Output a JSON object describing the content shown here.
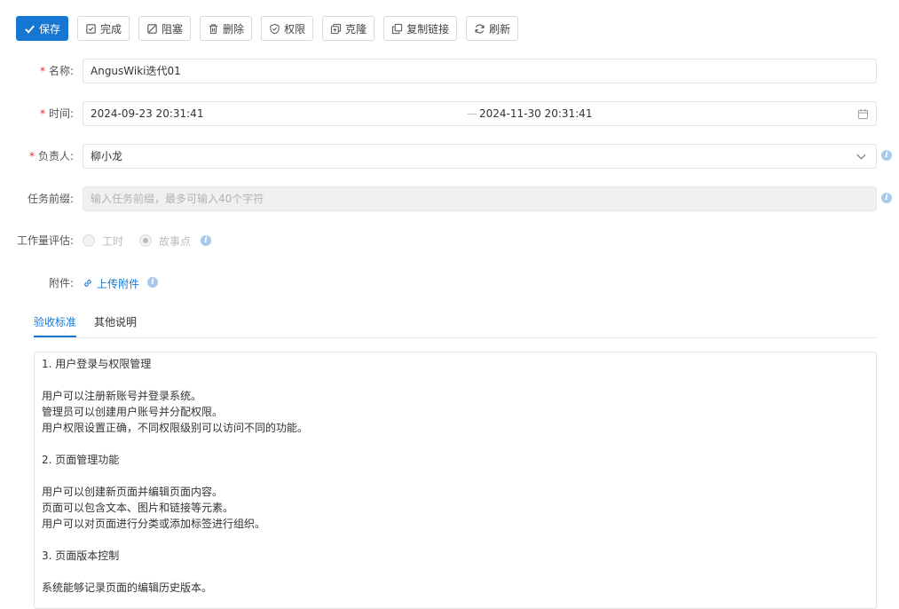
{
  "toolbar": {
    "save": "保存",
    "complete": "完成",
    "block": "阻塞",
    "delete": "删除",
    "permission": "权限",
    "clone": "克隆",
    "copy_link": "复制链接",
    "refresh": "刷新"
  },
  "form": {
    "name": {
      "label": "名称",
      "value": "AngusWiki迭代01"
    },
    "time": {
      "label": "时间",
      "start": "2024-09-23 20:31:41",
      "separator": "—",
      "end": "2024-11-30 20:31:41"
    },
    "owner": {
      "label": "负责人",
      "value": "柳小龙"
    },
    "prefix": {
      "label": "任务前缀",
      "placeholder": "输入任务前缀，最多可输入40个字符"
    },
    "estimate": {
      "label": "工作量评估",
      "option_hours": "工时",
      "option_story_points": "故事点",
      "selected": "故事点"
    },
    "attachment": {
      "label": "附件",
      "upload": "上传附件"
    },
    "colon": ":"
  },
  "tabs": [
    {
      "label": "验收标准",
      "active": true
    },
    {
      "label": "其他说明",
      "active": false
    }
  ],
  "editor": {
    "lines": [
      "1. 用户登录与权限管理",
      "",
      "用户可以注册新账号并登录系统。",
      "管理员可以创建用户账号并分配权限。",
      "用户权限设置正确，不同权限级别可以访问不同的功能。",
      "",
      "2. 页面管理功能",
      "",
      "用户可以创建新页面并编辑页面内容。",
      "页面可以包含文本、图片和链接等元素。",
      "用户可以对页面进行分类或添加标签进行组织。",
      "",
      "3. 页面版本控制",
      "",
      "系统能够记录页面的编辑历史版本。"
    ]
  },
  "colors": {
    "primary": "#1677d2",
    "required": "#f5222d",
    "info": "#a8c8ee"
  }
}
